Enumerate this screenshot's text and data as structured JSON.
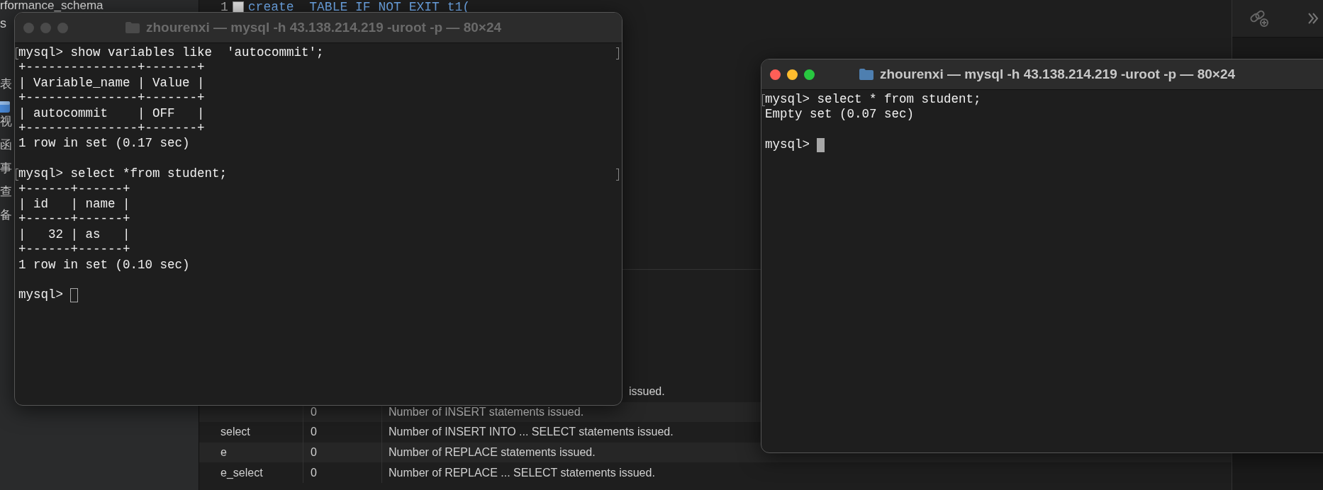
{
  "background_app": {
    "sidebar": {
      "items": [
        {
          "label": "rformance_schema"
        },
        {
          "label": "s"
        },
        {
          "label": "表"
        },
        {
          "label": "视"
        },
        {
          "label": "函"
        },
        {
          "label": "事"
        },
        {
          "label": "查"
        },
        {
          "label": "备"
        }
      ]
    },
    "editor": {
      "lines": [
        {
          "number": "1",
          "code": "create  TABLE IF NOT EXIT t1("
        }
      ]
    },
    "table": {
      "rows": [
        {
          "description": "issued."
        },
        {
          "value": "0",
          "description": "Number of INSERT statements issued."
        },
        {
          "name": "select",
          "value": "0",
          "description": "Number of INSERT INTO ... SELECT statements issued."
        },
        {
          "name": "e",
          "value": "0",
          "description": "Number of REPLACE statements issued."
        },
        {
          "name": "e_select",
          "value": "0",
          "description": "Number of REPLACE ... SELECT statements issued."
        }
      ]
    }
  },
  "terminals": [
    {
      "title": "zhourenxi — mysql -h 43.138.214.219 -uroot -p — 80×24",
      "active": false,
      "blocks": [
        {
          "marked": true,
          "lines": [
            "mysql> show variables like  'autocommit';",
            "+---------------+-------+",
            "| Variable_name | Value |",
            "+---------------+-------+",
            "| autocommit    | OFF   |",
            "+---------------+-------+",
            "1 row in set (0.17 sec)"
          ]
        },
        {
          "marked": true,
          "lines": [
            "mysql> select *from student;",
            "+------+------+",
            "| id   | name |",
            "+------+------+",
            "|   32 | as   |",
            "+------+------+",
            "1 row in set (0.10 sec)"
          ]
        }
      ],
      "prompt": "mysql>"
    },
    {
      "title": "zhourenxi — mysql -h 43.138.214.219 -uroot -p — 80×24",
      "active": true,
      "blocks": [
        {
          "marked": true,
          "lines": [
            "mysql> select * from student;",
            "Empty set (0.07 sec)"
          ]
        }
      ],
      "prompt": "mysql>"
    }
  ]
}
